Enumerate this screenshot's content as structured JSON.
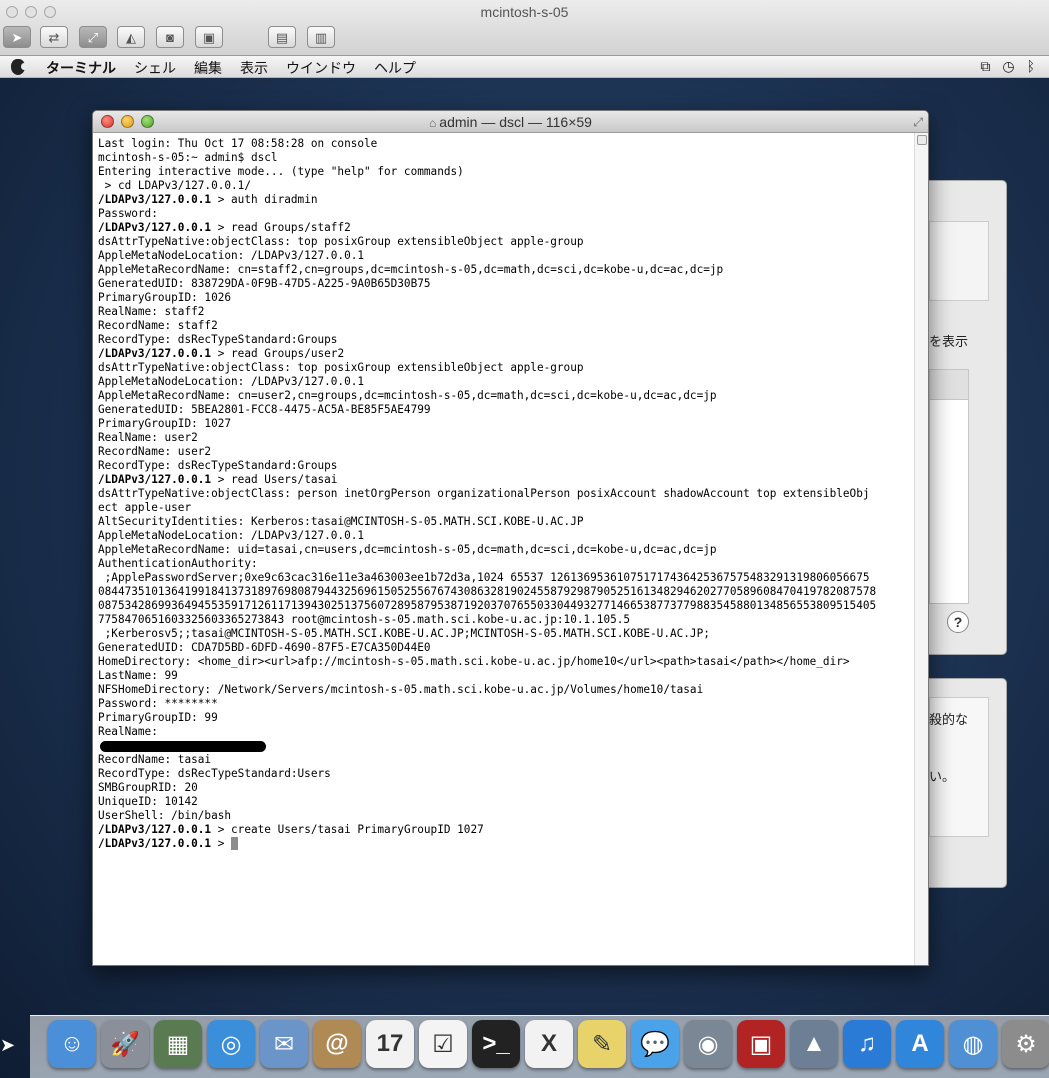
{
  "vm": {
    "title": "mcintosh-s-05",
    "toolbar_icons": [
      "pointer-icon",
      "remote-control-icon",
      "fit-screen-icon",
      "scale-icon",
      "screenshot-icon",
      "full-screen-icon",
      "clipboard-get-icon",
      "clipboard-send-icon"
    ]
  },
  "menubar": {
    "app_name": "ターミナル",
    "items": [
      "シェル",
      "編集",
      "表示",
      "ウインドウ",
      "ヘルプ"
    ]
  },
  "background_window": {
    "texts": [
      "を表示",
      "殺的な",
      "い。"
    ]
  },
  "terminal": {
    "title": "admin — dscl — 116×59",
    "lines": [
      "Last login: Thu Oct 17 08:58:28 on console",
      "mcintosh-s-05:~ admin$ dscl",
      "Entering interactive mode... (type \"help\" for commands)",
      " > cd LDAPv3/127.0.0.1/",
      "/LDAPv3/127.0.0.1 > auth diradmin",
      "Password:",
      "/LDAPv3/127.0.0.1 > read Groups/staff2",
      "dsAttrTypeNative:objectClass: top posixGroup extensibleObject apple-group",
      "AppleMetaNodeLocation: /LDAPv3/127.0.0.1",
      "AppleMetaRecordName: cn=staff2,cn=groups,dc=mcintosh-s-05,dc=math,dc=sci,dc=kobe-u,dc=ac,dc=jp",
      "GeneratedUID: 838729DA-0F9B-47D5-A225-9A0B65D30B75",
      "PrimaryGroupID: 1026",
      "RealName: staff2",
      "RecordName: staff2",
      "RecordType: dsRecTypeStandard:Groups",
      "/LDAPv3/127.0.0.1 > read Groups/user2",
      "dsAttrTypeNative:objectClass: top posixGroup extensibleObject apple-group",
      "AppleMetaNodeLocation: /LDAPv3/127.0.0.1",
      "AppleMetaRecordName: cn=user2,cn=groups,dc=mcintosh-s-05,dc=math,dc=sci,dc=kobe-u,dc=ac,dc=jp",
      "GeneratedUID: 5BEA2801-FCC8-4475-AC5A-BE85F5AE4799",
      "PrimaryGroupID: 1027",
      "RealName: user2",
      "RecordName: user2",
      "RecordType: dsRecTypeStandard:Groups",
      "/LDAPv3/127.0.0.1 > read Users/tasai",
      "dsAttrTypeNative:objectClass: person inetOrgPerson organizationalPerson posixAccount shadowAccount top extensibleObj",
      "ect apple-user",
      "AltSecurityIdentities: Kerberos:tasai@MCINTOSH-S-05.MATH.SCI.KOBE-U.AC.JP",
      "AppleMetaNodeLocation: /LDAPv3/127.0.0.1",
      "AppleMetaRecordName: uid=tasai,cn=users,dc=mcintosh-s-05,dc=math,dc=sci,dc=kobe-u,dc=ac,dc=jp",
      "AuthenticationAuthority:",
      " ;ApplePasswordServer;0xe9c63cac316e11e3a463003ee1b72d3a,1024 65537 126136953610751717436425367575483291319806056675",
      "084473510136419918413731897698087944325696150525567674308632819024558792987905251613482946202770589608470419782087578",
      "087534286993649455359171261171394302513756072895879538719203707655033044932771466538773779883545880134856553809515405",
      "7758470651603325603365273843 root@mcintosh-s-05.math.sci.kobe-u.ac.jp:10.1.105.5",
      " ;Kerberosv5;;tasai@MCINTOSH-S-05.MATH.SCI.KOBE-U.AC.JP;MCINTOSH-S-05.MATH.SCI.KOBE-U.AC.JP;",
      "GeneratedUID: CDA7D5BD-6DFD-4690-87F5-E7CA350D44E0",
      "HomeDirectory: <home_dir><url>afp://mcintosh-s-05.math.sci.kobe-u.ac.jp/home10</url><path>tasai</path></home_dir>",
      "LastName: 99",
      "NFSHomeDirectory: /Network/Servers/mcintosh-s-05.math.sci.kobe-u.ac.jp/Volumes/home10/tasai",
      "Password: ********",
      "PrimaryGroupID: 99",
      "RealName:",
      "",
      "RecordName: tasai",
      "RecordType: dsRecTypeStandard:Users",
      "SMBGroupRID: 20",
      "UniqueID: 10142",
      "UserShell: /bin/bash",
      "/LDAPv3/127.0.0.1 > create Users/tasai PrimaryGroupID 1027",
      "/LDAPv3/127.0.0.1 > "
    ],
    "redacted_line_index": 43
  },
  "dock": {
    "items": [
      {
        "name": "finder-icon",
        "glyph": "☺",
        "color": "#4a8fd8"
      },
      {
        "name": "launchpad-icon",
        "glyph": "🚀",
        "color": "#8a8f99"
      },
      {
        "name": "mission-control-icon",
        "glyph": "▦",
        "color": "#5a7a52"
      },
      {
        "name": "safari-icon",
        "glyph": "◎",
        "color": "#3b8ed9"
      },
      {
        "name": "mail-icon",
        "glyph": "✉",
        "color": "#6b94c9"
      },
      {
        "name": "contacts-icon",
        "glyph": "@",
        "color": "#b08a55"
      },
      {
        "name": "calendar-icon",
        "glyph": "17",
        "color": "#f2f2f2"
      },
      {
        "name": "reminders-icon",
        "glyph": "☑",
        "color": "#f4f4f4"
      },
      {
        "name": "terminal-icon",
        "glyph": ">_",
        "color": "#222222"
      },
      {
        "name": "x11-icon",
        "glyph": "X",
        "color": "#f2f2f2"
      },
      {
        "name": "stickies-icon",
        "glyph": "✎",
        "color": "#e8d36a"
      },
      {
        "name": "messages-icon",
        "glyph": "💬",
        "color": "#4aa3e8"
      },
      {
        "name": "facetime-icon",
        "glyph": "◉",
        "color": "#7b8794"
      },
      {
        "name": "photo-booth-icon",
        "glyph": "▣",
        "color": "#b22424"
      },
      {
        "name": "iphoto-icon",
        "glyph": "▲",
        "color": "#6c7f95"
      },
      {
        "name": "itunes-icon",
        "glyph": "♫",
        "color": "#2a7bd6"
      },
      {
        "name": "app-store-icon",
        "glyph": "A",
        "color": "#2f86db"
      },
      {
        "name": "network-icon",
        "glyph": "◍",
        "color": "#4f8fd4"
      },
      {
        "name": "system-preferences-icon",
        "glyph": "⚙",
        "color": "#8c8c8c"
      }
    ]
  }
}
